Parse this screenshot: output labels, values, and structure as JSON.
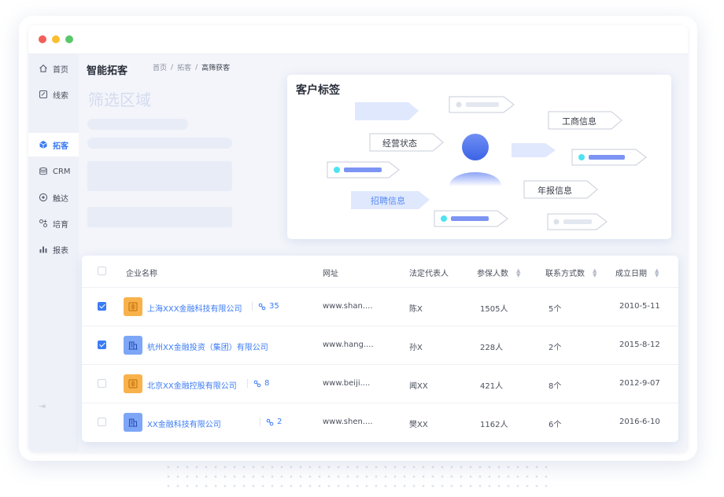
{
  "sidebar": {
    "items": [
      {
        "label": "首页",
        "icon": "home-icon"
      },
      {
        "label": "线索",
        "icon": "leads-icon"
      },
      {
        "label": "拓客",
        "icon": "cube-icon",
        "active": true
      },
      {
        "label": "CRM",
        "icon": "crm-icon"
      },
      {
        "label": "触达",
        "icon": "target-icon"
      },
      {
        "label": "培育",
        "icon": "nurture-icon"
      },
      {
        "label": "报表",
        "icon": "chart-icon"
      }
    ]
  },
  "header": {
    "title": "智能拓客",
    "breadcrumb": [
      "首页",
      "拓客",
      "高筛获客"
    ]
  },
  "filter": {
    "title": "筛选区域"
  },
  "tags": {
    "title": "客户标签",
    "labels": [
      "经营状态",
      "招聘信息",
      "工商信息",
      "年报信息"
    ]
  },
  "table": {
    "columns": [
      "企业名称",
      "网址",
      "法定代表人",
      "参保人数",
      "联系方式数",
      "成立日期"
    ],
    "rows": [
      {
        "checked": true,
        "logo": "orange",
        "name": "上海XXX金融科技有限公司",
        "people": "35",
        "website": "www.shan....",
        "legal": "陈X",
        "insured": "1505人",
        "contacts": "5个",
        "date": "2010-5-11"
      },
      {
        "checked": true,
        "logo": "blue",
        "name": "杭州XX金融投资（集团）有限公司",
        "people": "",
        "website": "www.hang....",
        "legal": "孙X",
        "insured": "228人",
        "contacts": "2个",
        "date": "2015-8-12"
      },
      {
        "checked": false,
        "logo": "orange",
        "name": "北京XX金融控股有限公司",
        "people": "8",
        "website": "www.beiji....",
        "legal": "闻XX",
        "insured": "421人",
        "contacts": "8个",
        "date": "2012-9-07"
      },
      {
        "checked": false,
        "logo": "blue",
        "name": "XX金融科技有限公司",
        "people": "2",
        "website": "www.shen....",
        "legal": "樊XX",
        "insured": "1162人",
        "contacts": "6个",
        "date": "2016-6-10"
      }
    ]
  },
  "colors": {
    "accent": "#3b7bf6",
    "tag_fill": "#dfe8fd",
    "cyan": "#4de3f0",
    "bar": "#7c94f3"
  }
}
